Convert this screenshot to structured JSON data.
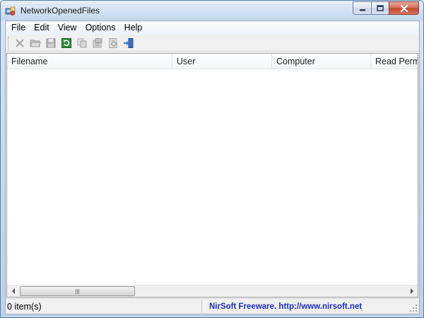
{
  "window": {
    "title": "NetworkOpenedFiles",
    "controls": [
      "minimize-icon",
      "maximize-icon",
      "close-icon"
    ]
  },
  "menu": {
    "items": [
      {
        "label": "File"
      },
      {
        "label": "Edit"
      },
      {
        "label": "View"
      },
      {
        "label": "Options"
      },
      {
        "label": "Help"
      }
    ]
  },
  "toolbar": {
    "buttons": [
      {
        "icon": "close-files-icon"
      },
      {
        "icon": "open-folder-icon"
      },
      {
        "icon": "save-icon"
      },
      {
        "icon": "refresh-icon"
      },
      {
        "icon": "copy-icon"
      },
      {
        "icon": "properties-icon"
      },
      {
        "icon": "html-report-icon"
      },
      {
        "icon": "exit-icon"
      }
    ]
  },
  "list": {
    "columns": [
      {
        "label": "Filename"
      },
      {
        "label": "User"
      },
      {
        "label": "Computer"
      },
      {
        "label": "Read Permi"
      }
    ],
    "rows": []
  },
  "status": {
    "count": "0 item(s)",
    "link": "NirSoft Freeware.  http://www.nirsoft.net"
  },
  "colors": {
    "link": "#1c2ec9",
    "close_button": "#c2442c"
  }
}
